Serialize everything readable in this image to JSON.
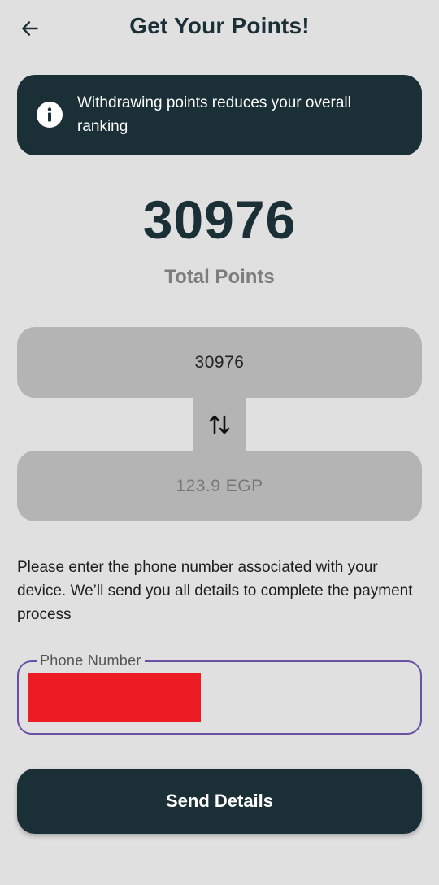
{
  "header": {
    "title": "Get Your Points!",
    "back_icon": "arrow-left-icon"
  },
  "banner": {
    "icon": "info-icon",
    "text": "Withdrawing points reduces your overall ranking"
  },
  "points": {
    "value": "30976",
    "label": "Total Points"
  },
  "converter": {
    "points_value": "30976",
    "swap_icon": "swap-vertical-icon",
    "currency_value": "123.9 EGP"
  },
  "instructions": "Please enter the phone number associated with your device. We’ll send you all details to complete the payment process",
  "phone_field": {
    "label": "Phone Number"
  },
  "send_button": {
    "label": "Send Details"
  },
  "colors": {
    "background": "#e0e0e0",
    "primary_dark": "#1b2f36",
    "converter_bg": "#b4b4b4",
    "field_border": "#6b4fa5",
    "redaction": "#ed1c24"
  }
}
